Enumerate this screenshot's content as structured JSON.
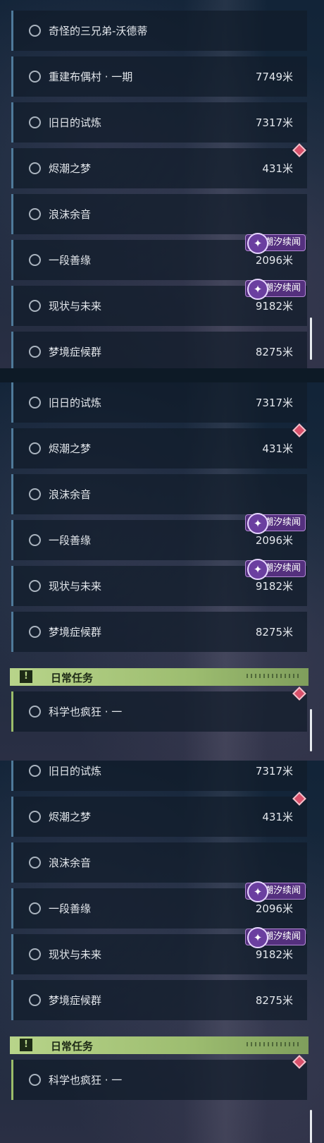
{
  "panels": [
    {
      "quests": [
        {
          "name": "奇怪的三兄弟-沃德蒂",
          "distance": ""
        },
        {
          "name": "重建布偶村 · 一期",
          "distance": "7749米"
        },
        {
          "name": "旧日的试炼",
          "distance": "7317米"
        },
        {
          "name": "烬潮之梦",
          "distance": "431米",
          "tracked": true
        },
        {
          "name": "浪沫余音",
          "distance": ""
        },
        {
          "name": "一段善缘",
          "distance": "2096米",
          "tag": "潮汐续闻"
        },
        {
          "name": "现状与未来",
          "distance": "9182米",
          "tag": "潮汐续闻"
        },
        {
          "name": "梦境症候群",
          "distance": "8275米"
        }
      ]
    },
    {
      "quests": [
        {
          "name": "旧日的试炼",
          "distance": "7317米"
        },
        {
          "name": "烬潮之梦",
          "distance": "431米",
          "tracked": true
        },
        {
          "name": "浪沫余音",
          "distance": ""
        },
        {
          "name": "一段善缘",
          "distance": "2096米",
          "tag": "潮汐续闻"
        },
        {
          "name": "现状与未来",
          "distance": "9182米",
          "tag": "潮汐续闻"
        },
        {
          "name": "梦境症候群",
          "distance": "8275米"
        }
      ],
      "section": {
        "icon": "exclamation-icon",
        "title": "日常任务"
      },
      "daily": [
        {
          "name": "科学也疯狂 · 一",
          "distance": "",
          "tracked": true
        }
      ]
    },
    {
      "quests": [
        {
          "name": "旧日的试炼",
          "distance": "7317米"
        },
        {
          "name": "烬潮之梦",
          "distance": "431米",
          "tracked": true
        },
        {
          "name": "浪沫余音",
          "distance": ""
        },
        {
          "name": "一段善缘",
          "distance": "2096米",
          "tag": "潮汐续闻"
        },
        {
          "name": "现状与未来",
          "distance": "9182米",
          "tag": "潮汐续闻"
        },
        {
          "name": "梦境症候群",
          "distance": "8275米"
        }
      ],
      "section": {
        "icon": "exclamation-icon",
        "title": "日常任务"
      },
      "daily": [
        {
          "name": "科学也疯狂 · 一",
          "distance": "",
          "tracked": true
        }
      ]
    }
  ],
  "icons": {
    "quest_status": "circle-outline-icon",
    "tracked_marker": "diamond-marker-icon",
    "tag_icon": "tide-sparkle-icon"
  },
  "colors": {
    "daily_accent": "#b8d48a",
    "tag_bg": "#54307e",
    "marker": "#d9506a",
    "quest_border": "#4f7a9a"
  }
}
